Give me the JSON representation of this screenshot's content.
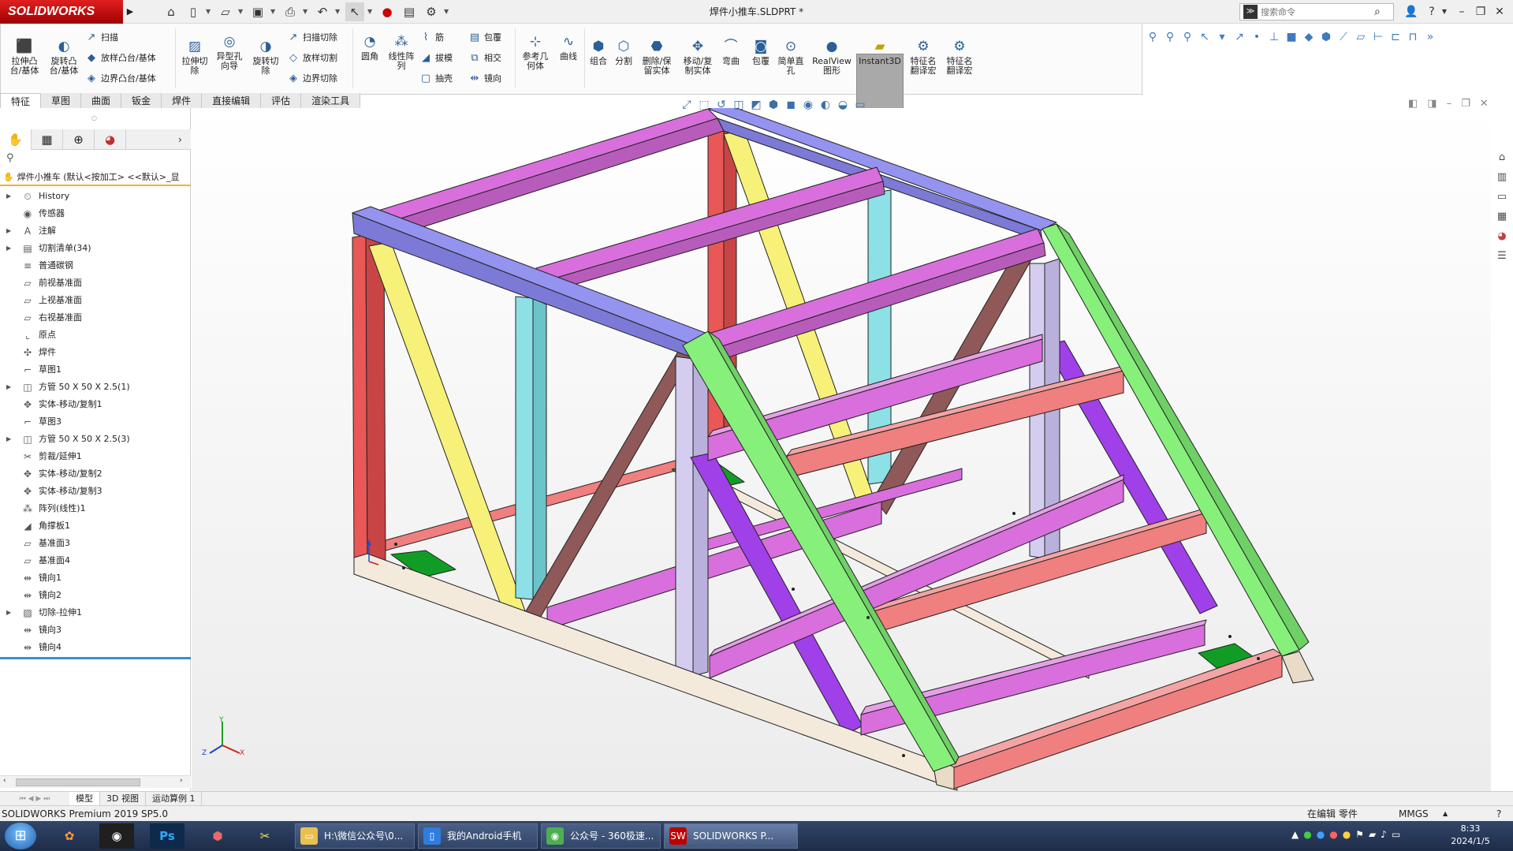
{
  "app": {
    "logo": "SOLIDWORKS",
    "window_title": "焊件小推车.SLDPRT *",
    "search_placeholder": "搜索命令"
  },
  "colors": {
    "accent": "#c00000",
    "magenta": "#d86fdc",
    "lilac": "#9593f0",
    "red": "#e95757",
    "yellow": "#f7f17a",
    "cyan": "#8ce0e6",
    "brown": "#8f5959",
    "green": "#86f07b",
    "purple": "#a040e8",
    "salmon": "#f07f7f",
    "lavender": "#d4cdf0",
    "cream": "#f4eadc",
    "gusset": "#119d25"
  },
  "ribbon": {
    "extrude": "拉伸凸\n台/基体",
    "revolve": "旋转凸\n台/基体",
    "sweep": "扫描",
    "loft": "放样凸台/基体",
    "boundary": "边界凸台/基体",
    "extrude_cut": "拉伸切\n除",
    "hole_wizard": "异型孔\n向导",
    "revolve_cut": "旋转切\n除",
    "sweep_cut": "扫描切除",
    "loft_cut": "放样切割",
    "boundary_cut": "边界切除",
    "fillet": "圆角",
    "linear_pattern": "线性阵\n列",
    "rib": "筋",
    "draft": "拔模",
    "shell": "抽壳",
    "wrap": "包覆",
    "intersect": "相交",
    "mirror": "镜向",
    "ref_geometry": "参考几\n何体",
    "curves": "曲线",
    "combine": "组合",
    "split": "分割",
    "delete_keep": "删除/保\n留实体",
    "move_copy": "移动/复\n制实体",
    "flex": "弯曲",
    "wrap2": "包覆",
    "simple_hole": "简单直\n孔",
    "realview": "RealView\n图形",
    "instant3d": "Instant3D",
    "feature_translate1": "特征名\n翻译宏",
    "feature_translate2": "特征名\n翻译宏"
  },
  "tabs": [
    "特征",
    "草图",
    "曲面",
    "钣金",
    "焊件",
    "直接编辑",
    "评估",
    "渲染工具"
  ],
  "tree": {
    "root": "焊件小推车 (默认<按加工> <<默认>_显",
    "items": [
      {
        "label": "History",
        "icon": "history-icon",
        "expand": true
      },
      {
        "label": "传感器",
        "icon": "sensor-icon",
        "expand": false
      },
      {
        "label": "注解",
        "icon": "annotation-icon",
        "expand": true
      },
      {
        "label": "切割清单(34)",
        "icon": "cutlist-icon",
        "expand": true
      },
      {
        "label": "普通碳钢",
        "icon": "material-icon",
        "expand": false
      },
      {
        "label": "前视基准面",
        "icon": "plane-icon",
        "expand": false
      },
      {
        "label": "上视基准面",
        "icon": "plane-icon",
        "expand": false
      },
      {
        "label": "右视基准面",
        "icon": "plane-icon",
        "expand": false
      },
      {
        "label": "原点",
        "icon": "origin-icon",
        "expand": false
      },
      {
        "label": "焊件",
        "icon": "weldment-icon",
        "expand": false
      },
      {
        "label": "草图1",
        "icon": "sketch-icon",
        "expand": false
      },
      {
        "label": "方管 50 X 50 X 2.5(1)",
        "icon": "structural-member-icon",
        "expand": true
      },
      {
        "label": "实体-移动/复制1",
        "icon": "move-body-icon",
        "expand": false
      },
      {
        "label": "草图3",
        "icon": "sketch-icon",
        "expand": false
      },
      {
        "label": "方管 50 X 50 X 2.5(3)",
        "icon": "structural-member-icon",
        "expand": true
      },
      {
        "label": "剪裁/延伸1",
        "icon": "trim-icon",
        "expand": false
      },
      {
        "label": "实体-移动/复制2",
        "icon": "move-body-icon",
        "expand": false
      },
      {
        "label": "实体-移动/复制3",
        "icon": "move-body-icon",
        "expand": false
      },
      {
        "label": "阵列(线性)1",
        "icon": "pattern-icon",
        "expand": false
      },
      {
        "label": "角撑板1",
        "icon": "gusset-icon",
        "expand": false
      },
      {
        "label": "基准面3",
        "icon": "plane-icon",
        "expand": false
      },
      {
        "label": "基准面4",
        "icon": "plane-icon",
        "expand": false
      },
      {
        "label": "镜向1",
        "icon": "mirror-icon",
        "expand": false
      },
      {
        "label": "镜向2",
        "icon": "mirror-icon",
        "expand": false
      },
      {
        "label": "切除-拉伸1",
        "icon": "cut-extrude-icon",
        "expand": true
      },
      {
        "label": "镜向3",
        "icon": "mirror-icon",
        "expand": false
      },
      {
        "label": "镜向4",
        "icon": "mirror-icon",
        "expand": false
      }
    ]
  },
  "bottom_tabs": [
    "模型",
    "3D 视图",
    "运动算例 1"
  ],
  "status": {
    "left": "SOLIDWORKS Premium 2019 SP5.0",
    "editing": "在编辑 零件",
    "units": "MMGS"
  },
  "triad": {
    "x": "X",
    "y": "Y",
    "z": "Z"
  },
  "taskbar": {
    "windows": [
      {
        "label": "H:\\微信公众号\\0...",
        "icon": "folder-icon"
      },
      {
        "label": "我的Android手机",
        "icon": "phone-icon"
      },
      {
        "label": "公众号 - 360极速...",
        "icon": "browser-icon"
      },
      {
        "label": "SOLIDWORKS P...",
        "icon": "solidworks-icon"
      }
    ],
    "ps": "Ps",
    "time": "8:33",
    "date": "2024/1/5"
  }
}
